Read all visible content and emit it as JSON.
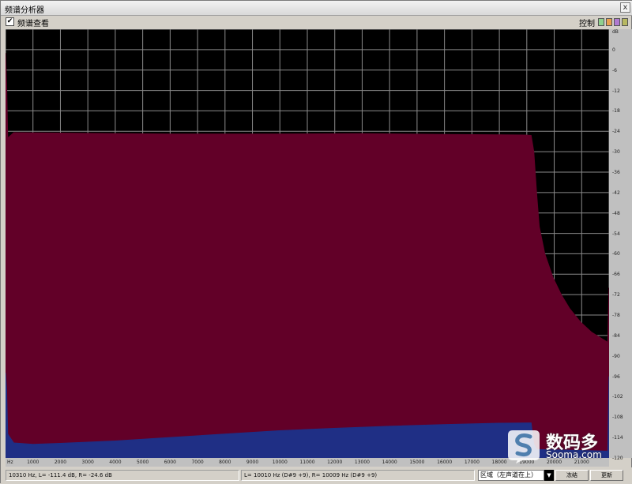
{
  "window": {
    "title": "频谱分析器",
    "close_label": "x"
  },
  "toolbar": {
    "checkbox_checked": true,
    "checkbox_label": "频谱查看",
    "control_label": "控制",
    "swatches": [
      {
        "name": "swatch-green",
        "color": "#8fd18f"
      },
      {
        "name": "swatch-orange",
        "color": "#e8a050"
      },
      {
        "name": "swatch-purple",
        "color": "#b07ad0"
      },
      {
        "name": "swatch-olive",
        "color": "#b8b860"
      }
    ]
  },
  "colors": {
    "plot_bg": "#000000",
    "grid": "#8a8a8a",
    "left_channel": "#620028",
    "right_channel": "#1f2f85"
  },
  "chart_data": {
    "type": "area",
    "title": "",
    "xlabel": "",
    "ylabel": "",
    "x_unit_label": "Hz",
    "y_unit_label": "dB",
    "xlim": [
      0,
      22050
    ],
    "ylim": [
      -120,
      6
    ],
    "x_ticks": [
      "Hz",
      "1000",
      "2000",
      "3000",
      "4000",
      "5000",
      "6000",
      "7000",
      "8000",
      "9000",
      "10000",
      "11000",
      "12000",
      "13000",
      "14000",
      "15000",
      "16000",
      "17000",
      "18000",
      "19000",
      "20000",
      "21000"
    ],
    "y_ticks": [
      "dB",
      "0",
      "-6",
      "-12",
      "-18",
      "-24",
      "-30",
      "-36",
      "-42",
      "-48",
      "-54",
      "-60",
      "-66",
      "-72",
      "-78",
      "-84",
      "-90",
      "-96",
      "-102",
      "-108",
      "-114",
      "-120"
    ],
    "grid": true,
    "series": [
      {
        "name": "L",
        "color_ref": "left_channel",
        "points": [
          [
            0,
            -1
          ],
          [
            40,
            -10
          ],
          [
            80,
            -26
          ],
          [
            300,
            -24.4
          ],
          [
            3000,
            -24.6
          ],
          [
            6000,
            -24.8
          ],
          [
            10000,
            -24.8
          ],
          [
            13000,
            -24.7
          ],
          [
            16000,
            -24.9
          ],
          [
            19000,
            -25.1
          ],
          [
            19200,
            -25.2
          ],
          [
            19300,
            -30
          ],
          [
            19400,
            -42
          ],
          [
            19500,
            -52
          ],
          [
            19700,
            -60
          ],
          [
            20000,
            -67
          ],
          [
            20300,
            -72
          ],
          [
            20600,
            -76
          ],
          [
            21000,
            -80
          ],
          [
            21400,
            -83
          ],
          [
            21800,
            -85
          ],
          [
            22000,
            -86
          ],
          [
            22040,
            -72
          ],
          [
            22050,
            -70
          ]
        ]
      },
      {
        "name": "R",
        "color_ref": "right_channel",
        "points": [
          [
            0,
            -95
          ],
          [
            40,
            -100
          ],
          [
            80,
            -113
          ],
          [
            300,
            -115.6
          ],
          [
            1000,
            -116
          ],
          [
            2000,
            -115.7
          ],
          [
            4000,
            -115
          ],
          [
            6000,
            -114
          ],
          [
            8000,
            -113
          ],
          [
            10000,
            -112
          ],
          [
            12000,
            -111.3
          ],
          [
            14000,
            -110.7
          ],
          [
            16000,
            -110.2
          ],
          [
            18000,
            -109.8
          ],
          [
            19200,
            -109.7
          ],
          [
            19300,
            -116
          ],
          [
            19400,
            -117.5
          ],
          [
            21000,
            -117.8
          ],
          [
            22000,
            -118
          ],
          [
            22040,
            -98
          ],
          [
            22050,
            -96
          ]
        ]
      }
    ]
  },
  "status": {
    "cursor_readout": "10310 Hz, L= -111.4 dB, R= -24.6 dB",
    "peak_readout": "L= 10010 Hz (D#9 +9), R= 10009 Hz (D#9 +9)",
    "region_select_value": "区域（左声道在上）",
    "button_1_label": "冻结",
    "button_2_label": "更新"
  },
  "watermark": {
    "logo": "S-icon",
    "name": "数码多",
    "url": "Sooma.com"
  }
}
